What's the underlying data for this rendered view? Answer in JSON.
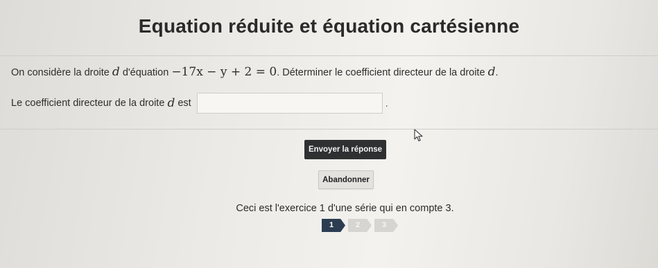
{
  "header": {
    "title": "Equation réduite et équation cartésienne"
  },
  "question": {
    "prefix": "On considère la droite",
    "line_name": "d",
    "mid": "d'équation",
    "equation": "−17x − y + 2 = 0",
    "suffix": ". Déterminer le coefficient directeur de la droite",
    "end_line_name": "d",
    "end": "."
  },
  "answer": {
    "label_prefix": "Le coefficient directeur de la droite",
    "line_name": "d",
    "label_suffix": "est",
    "value": "",
    "placeholder": "",
    "trailing": "."
  },
  "actions": {
    "submit_label": "Envoyer la réponse",
    "abandon_label": "Abandonner"
  },
  "series": {
    "text": "Ceci est l'exercice 1 d'une série qui en compte 3.",
    "steps": [
      {
        "label": "1",
        "active": true
      },
      {
        "label": "2",
        "active": false
      },
      {
        "label": "3",
        "active": false
      }
    ]
  },
  "colors": {
    "submit_bg": "#2f3031",
    "step_active": "#2c3d52",
    "step_inactive": "#d6d5d1"
  },
  "icons": {
    "cursor": "mouse-pointer-icon"
  }
}
